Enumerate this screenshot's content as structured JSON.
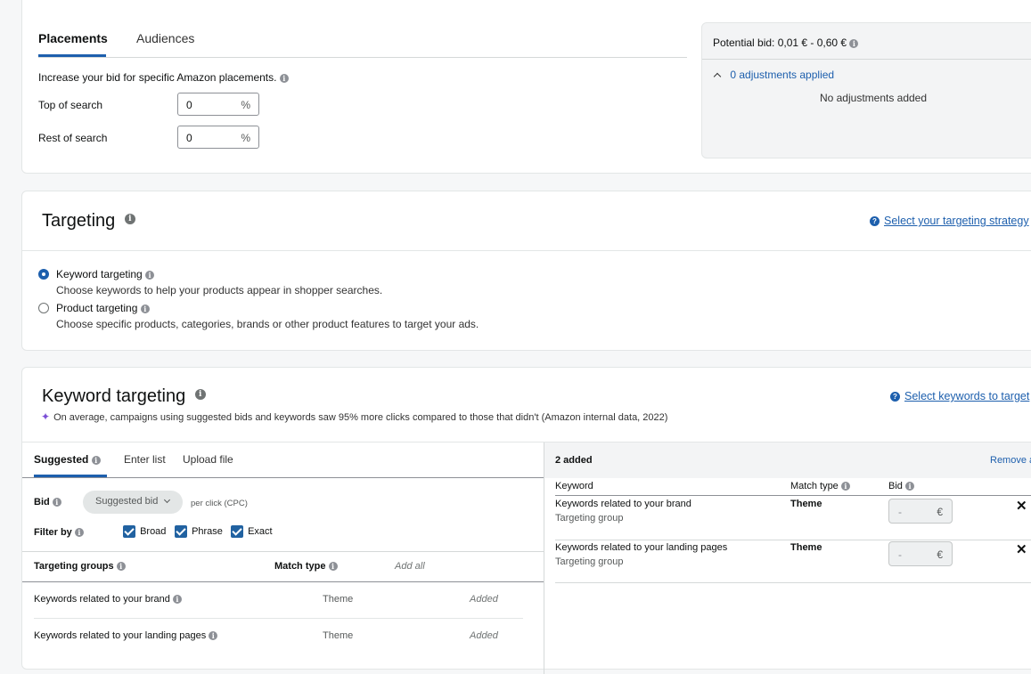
{
  "placements": {
    "tabs": [
      "Placements",
      "Audiences"
    ],
    "description": "Increase your bid for specific Amazon placements.",
    "rows": [
      {
        "label": "Top of search",
        "value": "0",
        "unit": "%"
      },
      {
        "label": "Rest of search",
        "value": "0",
        "unit": "%"
      }
    ],
    "potential_bid": "Potential bid: 0,01 € - 0,60 €",
    "adjustments": "0 adjustments applied",
    "no_adjustments": "No adjustments added"
  },
  "targeting": {
    "title": "Targeting",
    "strategy_link": "Select your targeting strategy",
    "options": [
      {
        "label": "Keyword targeting",
        "desc": "Choose keywords to help your products appear in shopper searches.",
        "selected": true
      },
      {
        "label": "Product targeting",
        "desc": "Choose specific products, categories, brands or other product features to target your ads.",
        "selected": false
      }
    ]
  },
  "keyword_targeting": {
    "title": "Keyword targeting",
    "link": "Select keywords to target",
    "insight": "On average, campaigns using suggested bids and keywords saw 95% more clicks compared to those that didn't (Amazon internal data, 2022)",
    "tabs": [
      "Suggested",
      "Enter list",
      "Upload file"
    ],
    "bid_label": "Bid",
    "bid_dropdown": "Suggested bid",
    "per_click": "per click (CPC)",
    "filter_label": "Filter by",
    "filters": [
      "Broad",
      "Phrase",
      "Exact"
    ],
    "headers": {
      "groups": "Targeting groups",
      "match": "Match type",
      "add_all": "Add all"
    },
    "rows": [
      {
        "name": "Keywords related to your brand",
        "match": "Theme",
        "status": "Added"
      },
      {
        "name": "Keywords related to your landing pages",
        "match": "Theme",
        "status": "Added"
      }
    ],
    "added": {
      "count": "2 added",
      "remove": "Remove a",
      "headers": {
        "keyword": "Keyword",
        "match": "Match type",
        "bid": "Bid"
      },
      "rows": [
        {
          "name": "Keywords related to your brand",
          "sub": "Targeting group",
          "match": "Theme",
          "bid": "-",
          "currency": "€"
        },
        {
          "name": "Keywords related to your landing pages",
          "sub": "Targeting group",
          "match": "Theme",
          "bid": "-",
          "currency": "€"
        }
      ]
    }
  },
  "colors": {
    "accent": "#1d5fad",
    "tab_active": "#0f1111"
  }
}
